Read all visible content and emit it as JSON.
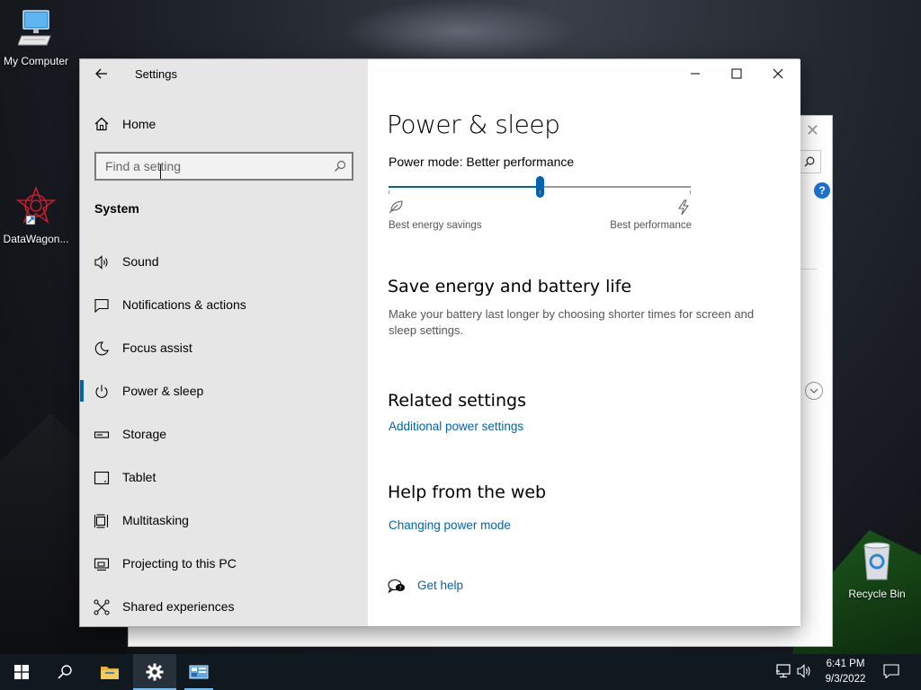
{
  "desktop": {
    "icons": [
      {
        "label": "My Computer"
      },
      {
        "label": "DataWagon..."
      },
      {
        "label": "Recycle Bin"
      }
    ]
  },
  "window": {
    "title": "Settings",
    "nav": {
      "home_label": "Home",
      "search_placeholder": "Find a setting",
      "section_title": "System",
      "items": [
        {
          "label": "Sound",
          "icon": "speaker-icon"
        },
        {
          "label": "Notifications & actions",
          "icon": "message-icon"
        },
        {
          "label": "Focus assist",
          "icon": "moon-icon"
        },
        {
          "label": "Power & sleep",
          "icon": "power-icon",
          "active": true
        },
        {
          "label": "Storage",
          "icon": "storage-icon"
        },
        {
          "label": "Tablet",
          "icon": "tablet-icon"
        },
        {
          "label": "Multitasking",
          "icon": "multitasking-icon"
        },
        {
          "label": "Projecting to this PC",
          "icon": "projector-icon"
        },
        {
          "label": "Shared experiences",
          "icon": "shared-icon"
        }
      ]
    },
    "content": {
      "page_title": "Power & sleep",
      "power_mode_label": "Power mode: Better performance",
      "slider": {
        "value": 0.5,
        "left_label": "Best energy savings",
        "right_label": "Best performance"
      },
      "save_energy": {
        "heading": "Save energy and battery life",
        "description": "Make your battery last longer by choosing shorter times for screen and sleep settings."
      },
      "related": {
        "heading": "Related settings",
        "link": "Additional power settings"
      },
      "help": {
        "heading": "Help from the web",
        "link": "Changing power mode"
      },
      "get_help": "Get help"
    },
    "accent": "#0063b1"
  },
  "taskbar": {
    "time": "6:41 PM",
    "date": "9/3/2022"
  }
}
